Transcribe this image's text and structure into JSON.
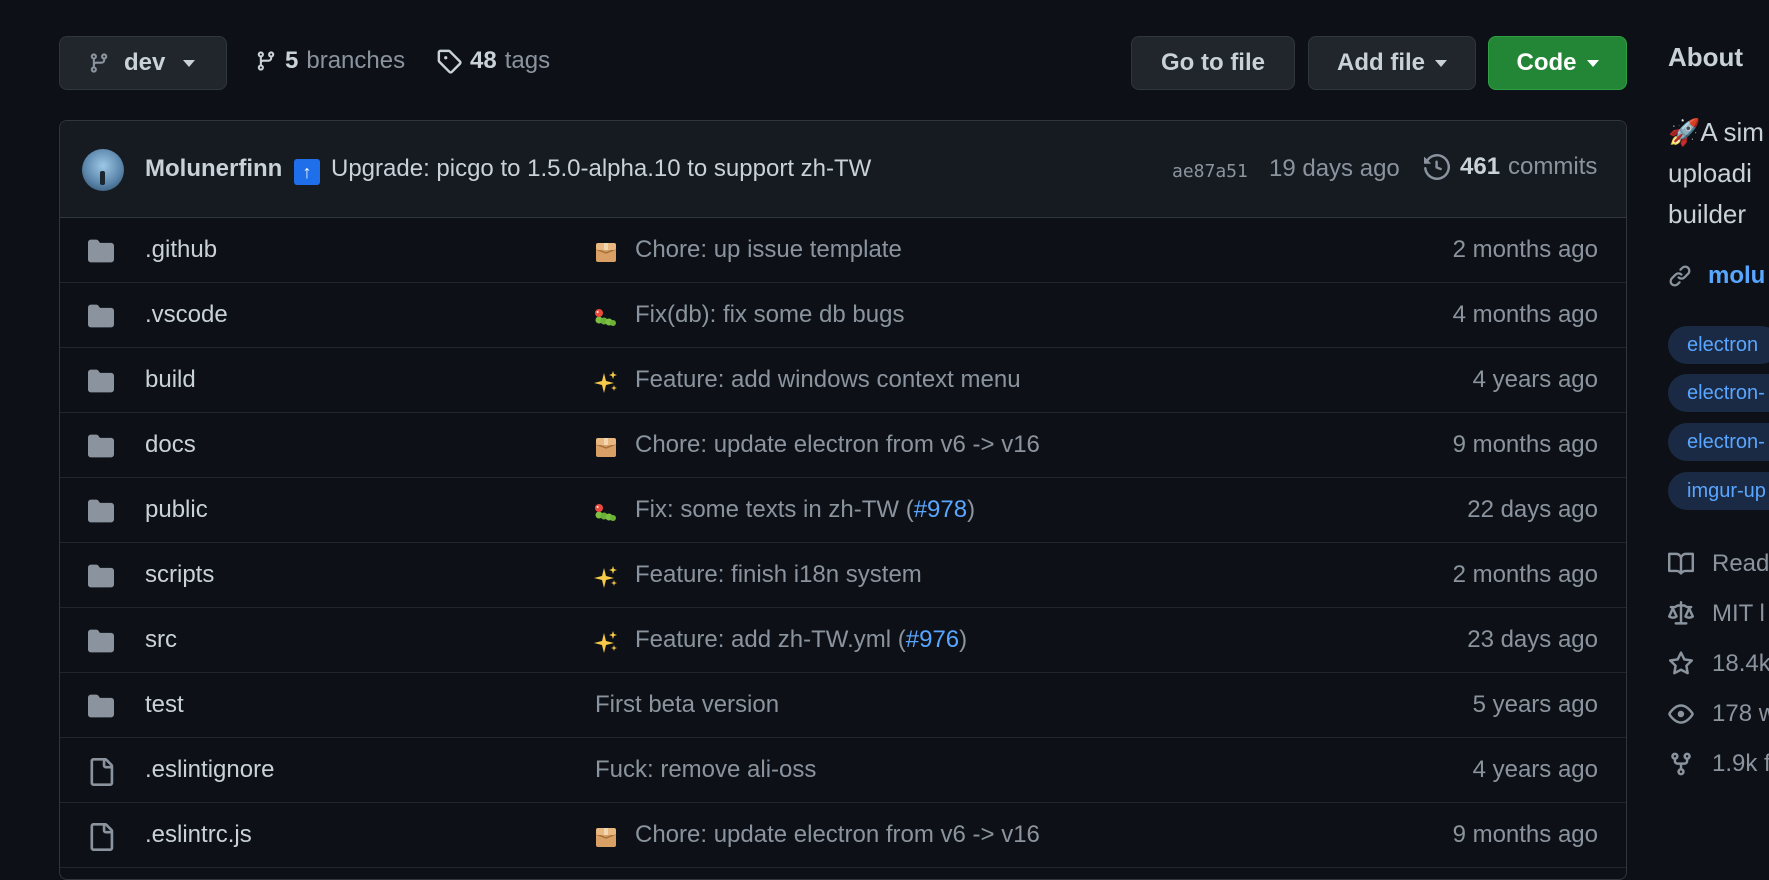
{
  "toolbar": {
    "branch": "dev",
    "branches_count": "5",
    "branches_label": "branches",
    "tags_count": "48",
    "tags_label": "tags",
    "go_to_file": "Go to file",
    "add_file": "Add file",
    "code": "Code"
  },
  "latest_commit": {
    "author": "Molunerfinn",
    "emoji": "↑",
    "message": "Upgrade: picgo to 1.5.0-alpha.10 to support zh-TW",
    "sha": "ae87a51",
    "date": "19 days ago",
    "commits_count": "461",
    "commits_label": "commits"
  },
  "files": [
    {
      "type": "folder",
      "name": ".github",
      "emoji": "package",
      "message": "Chore: up issue template",
      "age": "2 months ago"
    },
    {
      "type": "folder",
      "name": ".vscode",
      "emoji": "bug",
      "message": "Fix(db): fix some db bugs",
      "age": "4 months ago"
    },
    {
      "type": "folder",
      "name": "build",
      "emoji": "sparkles",
      "message": "Feature: add windows context menu",
      "age": "4 years ago"
    },
    {
      "type": "folder",
      "name": "docs",
      "emoji": "package",
      "message": "Chore: update electron from v6 -> v16",
      "age": "9 months ago"
    },
    {
      "type": "folder",
      "name": "public",
      "emoji": "bug",
      "message": "Fix: some texts in zh-TW (",
      "link": "#978",
      "message_end": ")",
      "age": "22 days ago"
    },
    {
      "type": "folder",
      "name": "scripts",
      "emoji": "sparkles",
      "message": "Feature: finish i18n system",
      "age": "2 months ago"
    },
    {
      "type": "folder",
      "name": "src",
      "emoji": "sparkles",
      "message": "Feature: add zh-TW.yml (",
      "link": "#976",
      "message_end": ")",
      "age": "23 days ago"
    },
    {
      "type": "folder",
      "name": "test",
      "emoji": "",
      "message": "First beta version",
      "age": "5 years ago"
    },
    {
      "type": "file",
      "name": ".eslintignore",
      "emoji": "",
      "message": "Fuck: remove ali-oss",
      "age": "4 years ago"
    },
    {
      "type": "file",
      "name": ".eslintrc.js",
      "emoji": "package",
      "message": "Chore: update electron from v6 -> v16",
      "age": "9 months ago"
    }
  ],
  "about": {
    "title": "About",
    "description_lines": [
      "🚀A sim",
      "uploadi",
      "builder"
    ],
    "website": "molu",
    "topics": [
      "electron",
      "electron-",
      "electron-",
      "imgur-up"
    ],
    "readme": "Read",
    "license": "MIT l",
    "stars": "18.4k",
    "watchers": "178 w",
    "forks": "1.9k f"
  },
  "colors": {
    "background": "#0d1117",
    "accent_link": "#58a6ff",
    "code_button": "#238636",
    "muted_text": "#8b949e"
  }
}
